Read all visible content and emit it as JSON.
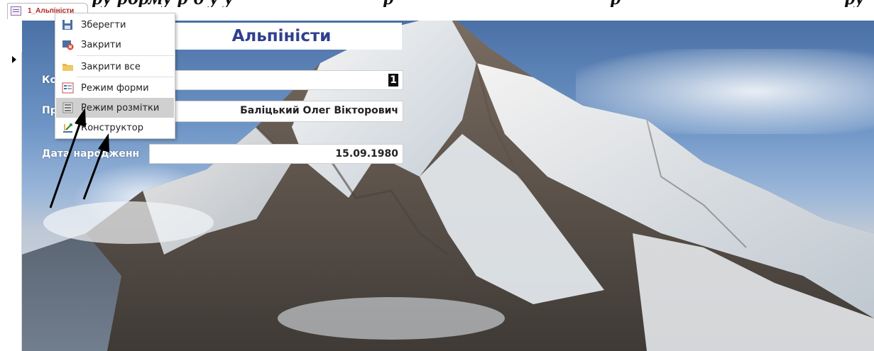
{
  "document_crop_text": {
    "part1": "ру рорму р д у у",
    "part2": "р",
    "part3": "р",
    "part4": "ру"
  },
  "tab": {
    "label": "1_Альпіністи",
    "icon": "form-icon"
  },
  "form": {
    "title": "Альпіністи",
    "fields": [
      {
        "label": "Ко",
        "value": "1"
      },
      {
        "label": "Пр",
        "value": "Баліцький Олег Вікторович"
      },
      {
        "label": "Дата народженн",
        "value": "15.09.1980"
      }
    ]
  },
  "context_menu": {
    "items": [
      {
        "label": "Зберегти",
        "icon": "save-icon"
      },
      {
        "label": "Закрити",
        "icon": "close-form-icon"
      },
      {
        "label": "Закрити все",
        "icon": "folder-icon"
      },
      {
        "label": "Режим форми",
        "icon": "form-view-icon"
      },
      {
        "label": "Режим розмітки",
        "icon": "layout-view-icon",
        "highlighted": true
      },
      {
        "label": "Конструктор",
        "icon": "design-view-icon"
      }
    ]
  },
  "colors": {
    "title_text": "#2f3f8f",
    "tab_label": "#b22424",
    "menu_highlight": "#d0d0d0"
  }
}
